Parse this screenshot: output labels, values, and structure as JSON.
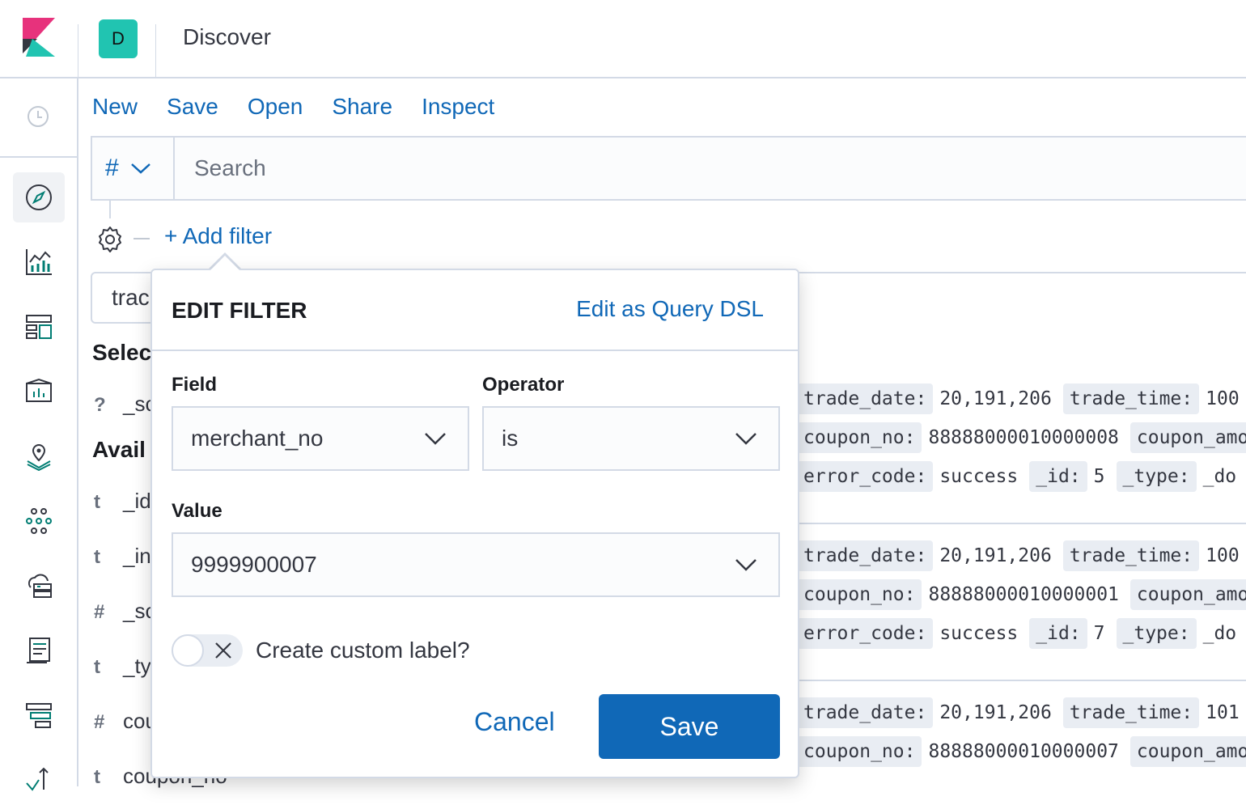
{
  "header": {
    "space_initial": "D",
    "app_title": "Discover"
  },
  "topnav": {
    "items": [
      "New",
      "Save",
      "Open",
      "Share",
      "Inspect"
    ]
  },
  "querybar": {
    "language_symbol": "#",
    "search_placeholder": "Search"
  },
  "filter_bar": {
    "add_filter_label": "+ Add filter"
  },
  "sidebar": {
    "index_pattern_fragment": "trac",
    "selected_heading": "Selec",
    "available_heading": "Avail",
    "selected_fields": [
      {
        "type": "?",
        "name": "_sc"
      }
    ],
    "available_fields": [
      {
        "type": "t",
        "name": "_id"
      },
      {
        "type": "t",
        "name": "_in"
      },
      {
        "type": "#",
        "name": "_sc"
      },
      {
        "type": "t",
        "name": "_ty"
      },
      {
        "type": "#",
        "name": "cou"
      },
      {
        "type": "t",
        "name": "coupon_no"
      }
    ]
  },
  "documents": [
    {
      "lines": [
        [
          [
            "trade_date:",
            "20,191,206"
          ],
          [
            "trade_time:",
            "100"
          ]
        ],
        [
          [
            "coupon_no:",
            "88888000010000008"
          ],
          [
            "coupon_amo",
            ""
          ]
        ],
        [
          [
            "error_code:",
            "success"
          ],
          [
            "_id:",
            "5"
          ],
          [
            "_type:",
            "_do"
          ]
        ]
      ]
    },
    {
      "lines": [
        [
          [
            "trade_date:",
            "20,191,206"
          ],
          [
            "trade_time:",
            "100"
          ]
        ],
        [
          [
            "coupon_no:",
            "88888000010000001"
          ],
          [
            "coupon_amo",
            ""
          ]
        ],
        [
          [
            "error_code:",
            "success"
          ],
          [
            "_id:",
            "7"
          ],
          [
            "_type:",
            "_do"
          ]
        ]
      ]
    },
    {
      "lines": [
        [
          [
            "trade_date:",
            "20,191,206"
          ],
          [
            "trade_time:",
            "101"
          ]
        ],
        [
          [
            "coupon_no:",
            "88888000010000007"
          ],
          [
            "coupon_amo",
            ""
          ]
        ]
      ]
    }
  ],
  "edit_filter": {
    "title": "EDIT FILTER",
    "edit_dsl_link": "Edit as Query DSL",
    "field_label": "Field",
    "field_value": "merchant_no",
    "operator_label": "Operator",
    "operator_value": "is",
    "value_label": "Value",
    "value_value": "9999900007",
    "custom_label_text": "Create custom label?",
    "custom_label_enabled": false,
    "cancel_label": "Cancel",
    "save_label": "Save"
  },
  "colors": {
    "link": "#1068b7",
    "primary_button": "#1068b7",
    "space_avatar": "#21c4b1",
    "border": "#d3dae6",
    "nav_icon": "#017d73"
  },
  "nav_icons": [
    "clock-icon",
    "compass-icon",
    "visualize-icon",
    "dashboard-icon",
    "canvas-icon",
    "maps-icon",
    "ml-icon",
    "infrastructure-icon",
    "logs-icon",
    "apm-icon",
    "uptime-icon"
  ]
}
